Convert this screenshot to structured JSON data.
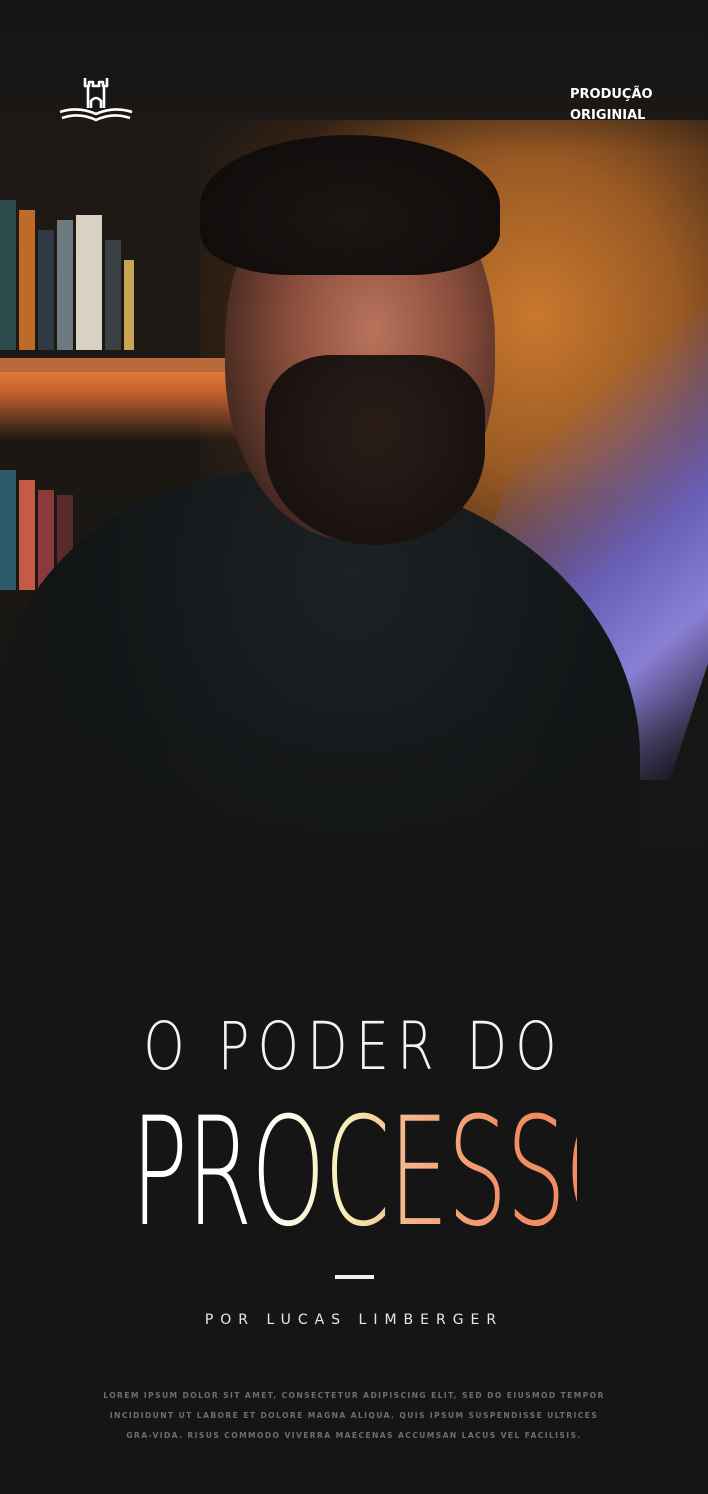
{
  "header": {
    "logo_icon": "castle-book-icon",
    "badge_line1": "PRODUÇÃO",
    "badge_line2": "ORIGINIAL"
  },
  "hero": {
    "image": "man-speaking-portrait"
  },
  "title": {
    "line1": "O PODER DO",
    "line2": "PROCESSO",
    "gradient_colors": [
      "#ffffff",
      "#f6eeb3",
      "#f4b58a",
      "#f08e63"
    ]
  },
  "byline": "POR LUCAS LIMBERGER",
  "body_text": "LOREM IPSUM DOLOR SIT AMET, CONSECTETUR ADIPISCING ELIT, SED DO EIUSMOD TEMPOR INCIDIDUNT UT LABORE ET DOLORE MAGNA ALIQUA. QUIS IPSUM SUSPENDISSE ULTRICES GRA-VIDA. RISUS COMMODO VIVERRA MAECENAS ACCUMSAN LACUS VEL FACILISIS.",
  "colors": {
    "background": "#151515",
    "accent_warm": "#f08e63",
    "accent_light": "#f6eeb3"
  }
}
